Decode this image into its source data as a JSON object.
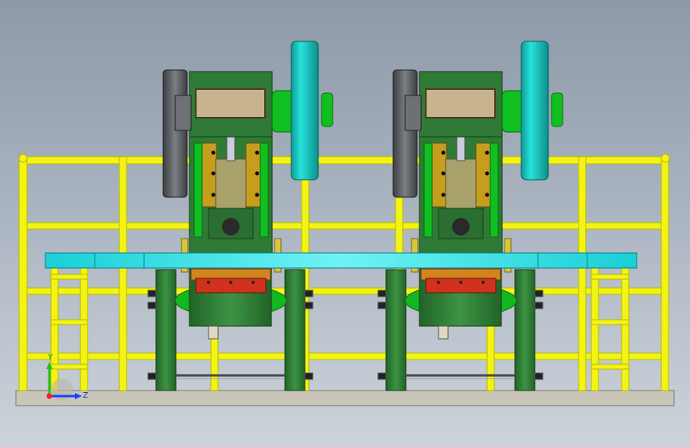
{
  "viewport": {
    "axis_labels": {
      "y": "Y",
      "z": "Z"
    }
  },
  "colors": {
    "background_top": "#8d99a9",
    "background_bottom": "#cdd3da",
    "railing": "#f4f414",
    "railing_edge": "#b9b900",
    "frame_green": "#2f7a36",
    "frame_green_light": "#3fa545",
    "bright_green": "#10c020",
    "flywheel": "#15c6c0",
    "flywheel_dark": "#0b8a86",
    "table_cyan": "#26e0e6",
    "die_red": "#d0321e",
    "die_orange": "#d2851e",
    "ram_khaki": "#a8a26a",
    "guide_gold": "#c79d1e",
    "window_tan": "#c8b48c",
    "wheel_grey": "#55595c",
    "base_plate": "#c9c6b9",
    "axis_x": "#ff2020",
    "axis_y": "#20c020",
    "axis_z": "#2040ff"
  }
}
